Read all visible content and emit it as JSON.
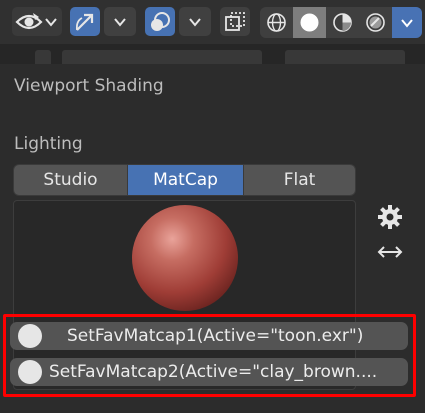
{
  "toolbar": {
    "icons": [
      "eye-icon",
      "gizmo-arrow-icon",
      "overlay-circles-icon",
      "xray-toggle-icon"
    ],
    "shading_modes": [
      "wireframe-icon",
      "solid-icon",
      "material-preview-icon",
      "rendered-icon"
    ],
    "active_shading": "solid",
    "dropdown_icon": "chevron-down-icon",
    "accent_color": "#4772b3"
  },
  "popup": {
    "title": "Viewport Shading",
    "lighting_label": "Lighting",
    "lighting_options": [
      "Studio",
      "MatCap",
      "Flat"
    ],
    "lighting_selected": "MatCap",
    "preview_icons": [
      "gear-icon",
      "flip-arrows-icon"
    ]
  },
  "favorites": {
    "items": [
      {
        "label": "SetFavMatcap1(Active=\"toon.exr\")"
      },
      {
        "label": "SetFavMatcap2(Active=\"clay_brown...."
      }
    ],
    "highlight_color": "#ff0000"
  }
}
